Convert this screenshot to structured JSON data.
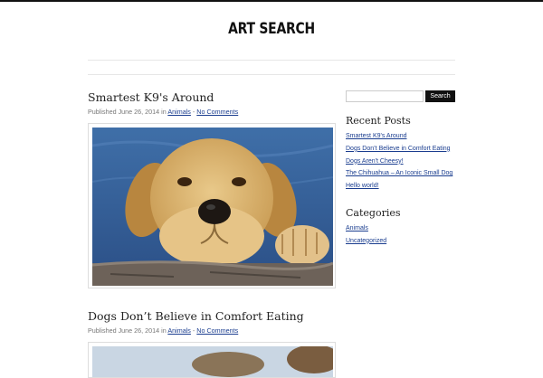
{
  "site": {
    "title": "ART SEARCH"
  },
  "posts": [
    {
      "title": "Smartest K9's Around",
      "meta_prefix": "Published June 26, 2014 in ",
      "category": "Animals",
      "separator": " - ",
      "comments": "No Comments"
    },
    {
      "title": "Dogs Don’t Believe in Comfort Eating",
      "meta_prefix": "Published June 26, 2014 in ",
      "category": "Animals",
      "separator": " - ",
      "comments": "No Comments"
    }
  ],
  "sidebar": {
    "search": {
      "placeholder": "",
      "button_label": "Search"
    },
    "recent_posts": {
      "title": "Recent Posts",
      "items": [
        "Smartest K9's Around",
        "Dogs Don’t Believe in Comfort Eating",
        "Dogs Aren't Cheesy!",
        "The Chihuahua – An Iconic Small Dog",
        "Hello world!"
      ]
    },
    "categories": {
      "title": "Categories",
      "items": [
        "Animals",
        "Uncategorized"
      ]
    }
  },
  "colors": {
    "link": "#1a3d8f",
    "button_bg": "#111111",
    "title": "#222222"
  }
}
